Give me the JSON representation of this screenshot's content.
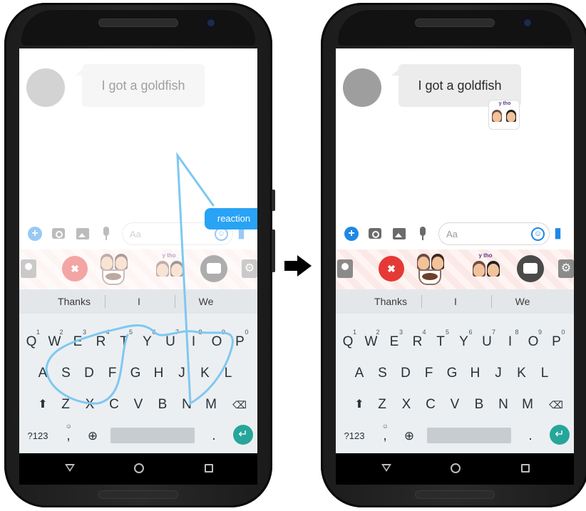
{
  "message": "I got a goldfish",
  "sticker_caption": "y tho",
  "input_placeholder": "Aa",
  "suggestions": [
    "Thanks",
    "I",
    "We"
  ],
  "row1": [
    {
      "k": "Q",
      "h": "1"
    },
    {
      "k": "W",
      "h": "2"
    },
    {
      "k": "E",
      "h": "3"
    },
    {
      "k": "R",
      "h": "4"
    },
    {
      "k": "T",
      "h": "5"
    },
    {
      "k": "Y",
      "h": "6"
    },
    {
      "k": "U",
      "h": "7"
    },
    {
      "k": "I",
      "h": "8"
    },
    {
      "k": "O",
      "h": "9"
    },
    {
      "k": "P",
      "h": "0"
    }
  ],
  "row2": [
    "A",
    "S",
    "D",
    "F",
    "G",
    "H",
    "J",
    "K",
    "L"
  ],
  "row3": [
    "Z",
    "X",
    "C",
    "V",
    "B",
    "N",
    "M"
  ],
  "bottom_row": {
    "symbols": "?123",
    "comma": ",",
    "period": ".",
    "comma_hint": "☺"
  },
  "left_phone": {
    "tooltip": "reaction"
  },
  "colors": {
    "accent": "#1e88e5",
    "swipe": "#7ec8f2",
    "enter": "#26a69a",
    "tooltip": "#29a3f5"
  }
}
